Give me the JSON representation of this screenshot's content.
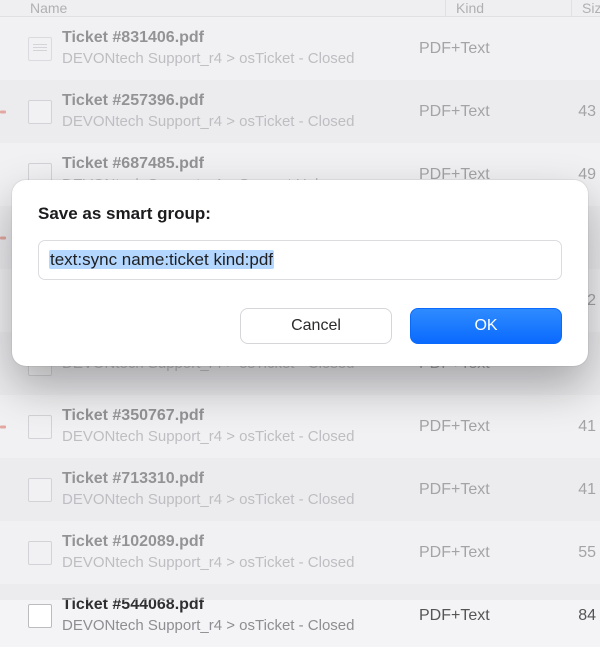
{
  "columns": {
    "name": "Name",
    "kind": "Kind",
    "size": "Size"
  },
  "kind_label": "PDF+Text",
  "path_common": "DEVONtech Support_r4 > osTicket - Closed",
  "rows": [
    {
      "title": "Ticket #831406.pdf",
      "path": "DEVONtech Support_r4 > osTicket - Closed",
      "size": "",
      "red": false
    },
    {
      "title": "Ticket #257396.pdf",
      "path": "DEVONtech Support_r4 > osTicket - Closed",
      "size": "43",
      "red": true
    },
    {
      "title": "Ticket #687485.pdf",
      "path": "DEVONtech Support_r4 > Support Hub",
      "size": "49",
      "red": false
    },
    {
      "title": "",
      "path": "",
      "size": "",
      "red": true
    },
    {
      "title": "",
      "path": "",
      "size": "2",
      "red": false
    },
    {
      "title": "",
      "path": "DEVONtech Support_r4 > osTicket - Closed",
      "size": "",
      "red": false
    },
    {
      "title": "Ticket #350767.pdf",
      "path": "DEVONtech Support_r4 > osTicket - Closed",
      "size": "41",
      "red": true
    },
    {
      "title": "Ticket #713310.pdf",
      "path": "DEVONtech Support_r4 > osTicket - Closed",
      "size": "41",
      "red": false
    },
    {
      "title": "Ticket #102089.pdf",
      "path": "DEVONtech Support_r4 > osTicket - Closed",
      "size": "55",
      "red": false
    },
    {
      "title": "Ticket #544068.pdf",
      "path": "DEVONtech Support_r4 > osTicket - Closed",
      "size": "84",
      "red": false
    }
  ],
  "dialog": {
    "title": "Save as smart group:",
    "input_value": "text:sync name:ticket kind:pdf",
    "cancel": "Cancel",
    "ok": "OK"
  }
}
